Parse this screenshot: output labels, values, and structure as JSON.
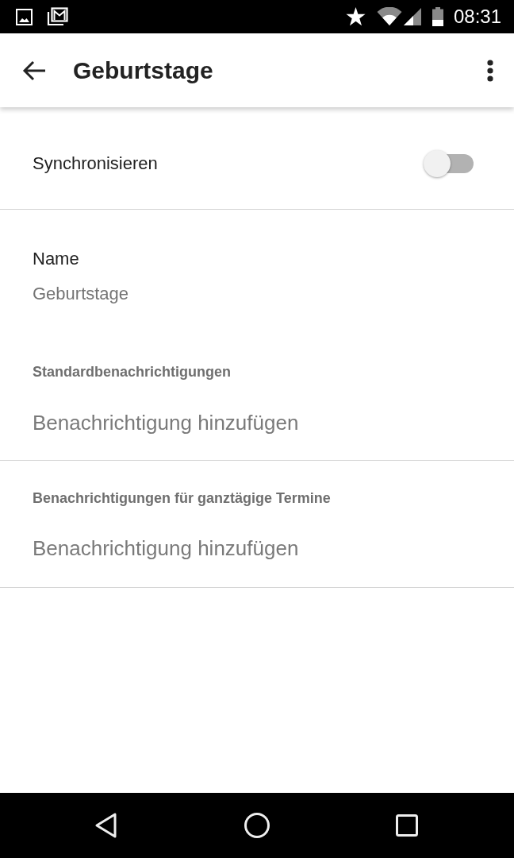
{
  "status_bar": {
    "time": "08:31"
  },
  "app_bar": {
    "title": "Geburtstage"
  },
  "sync": {
    "label": "Synchronisieren",
    "on": false
  },
  "name": {
    "label": "Name",
    "value": "Geburtstage"
  },
  "notification_sections": [
    {
      "heading": "Standardbenachrichtigungen",
      "action": "Benachrichtigung hinzufügen"
    },
    {
      "heading": "Benachrichtigungen für ganztägige Termine",
      "action": "Benachrichtigung hinzufügen"
    }
  ]
}
